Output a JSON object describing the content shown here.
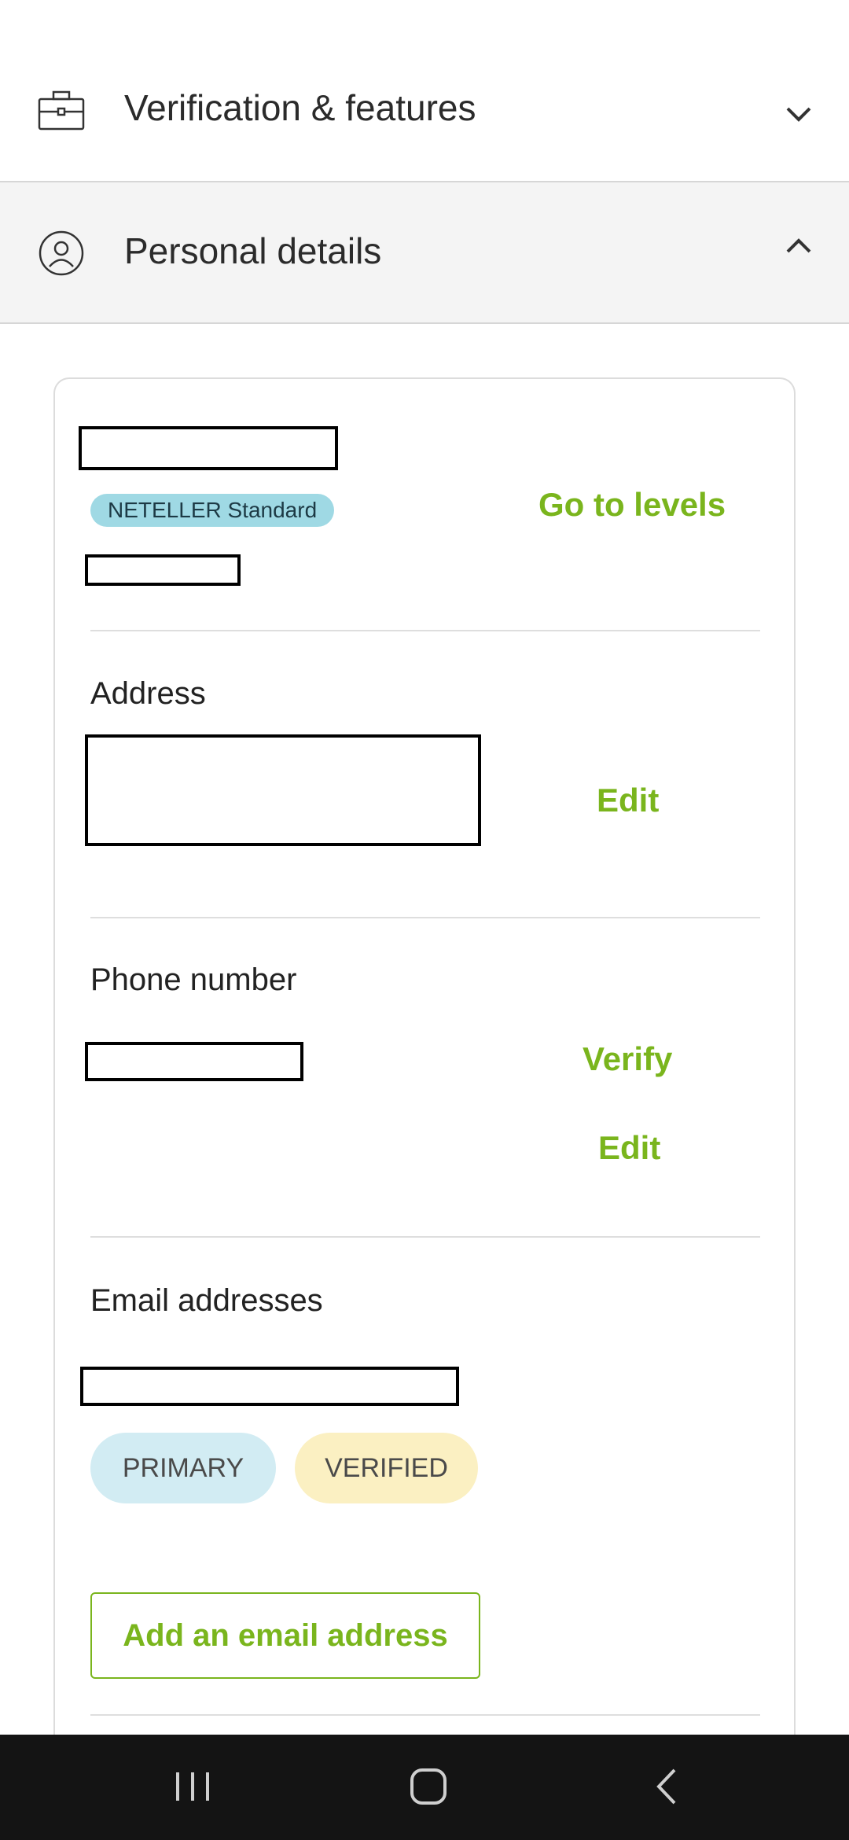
{
  "accordion": {
    "verification": {
      "title": "Verification & features",
      "icon": "briefcase-icon",
      "state": "collapsed"
    },
    "personal": {
      "title": "Personal details",
      "icon": "user-circle-icon",
      "state": "expanded"
    }
  },
  "personal_details": {
    "level_badge": "NETELLER Standard",
    "go_to_levels": "Go to levels",
    "address": {
      "label": "Address",
      "edit": "Edit"
    },
    "phone": {
      "label": "Phone number",
      "verify": "Verify",
      "edit": "Edit"
    },
    "email": {
      "label": "Email addresses",
      "badges": {
        "primary": "PRIMARY",
        "verified": "VERIFIED"
      },
      "add_button": "Add an email address"
    }
  },
  "colors": {
    "accent": "#7ab51d",
    "badge_blue": "#9fd9e4",
    "primary_pill": "#d2ecf3",
    "verified_pill": "#fbf0c2",
    "nav_bg": "#141414"
  },
  "system_nav": {
    "recent": "recent-apps-icon",
    "home": "home-icon",
    "back": "back-icon"
  }
}
